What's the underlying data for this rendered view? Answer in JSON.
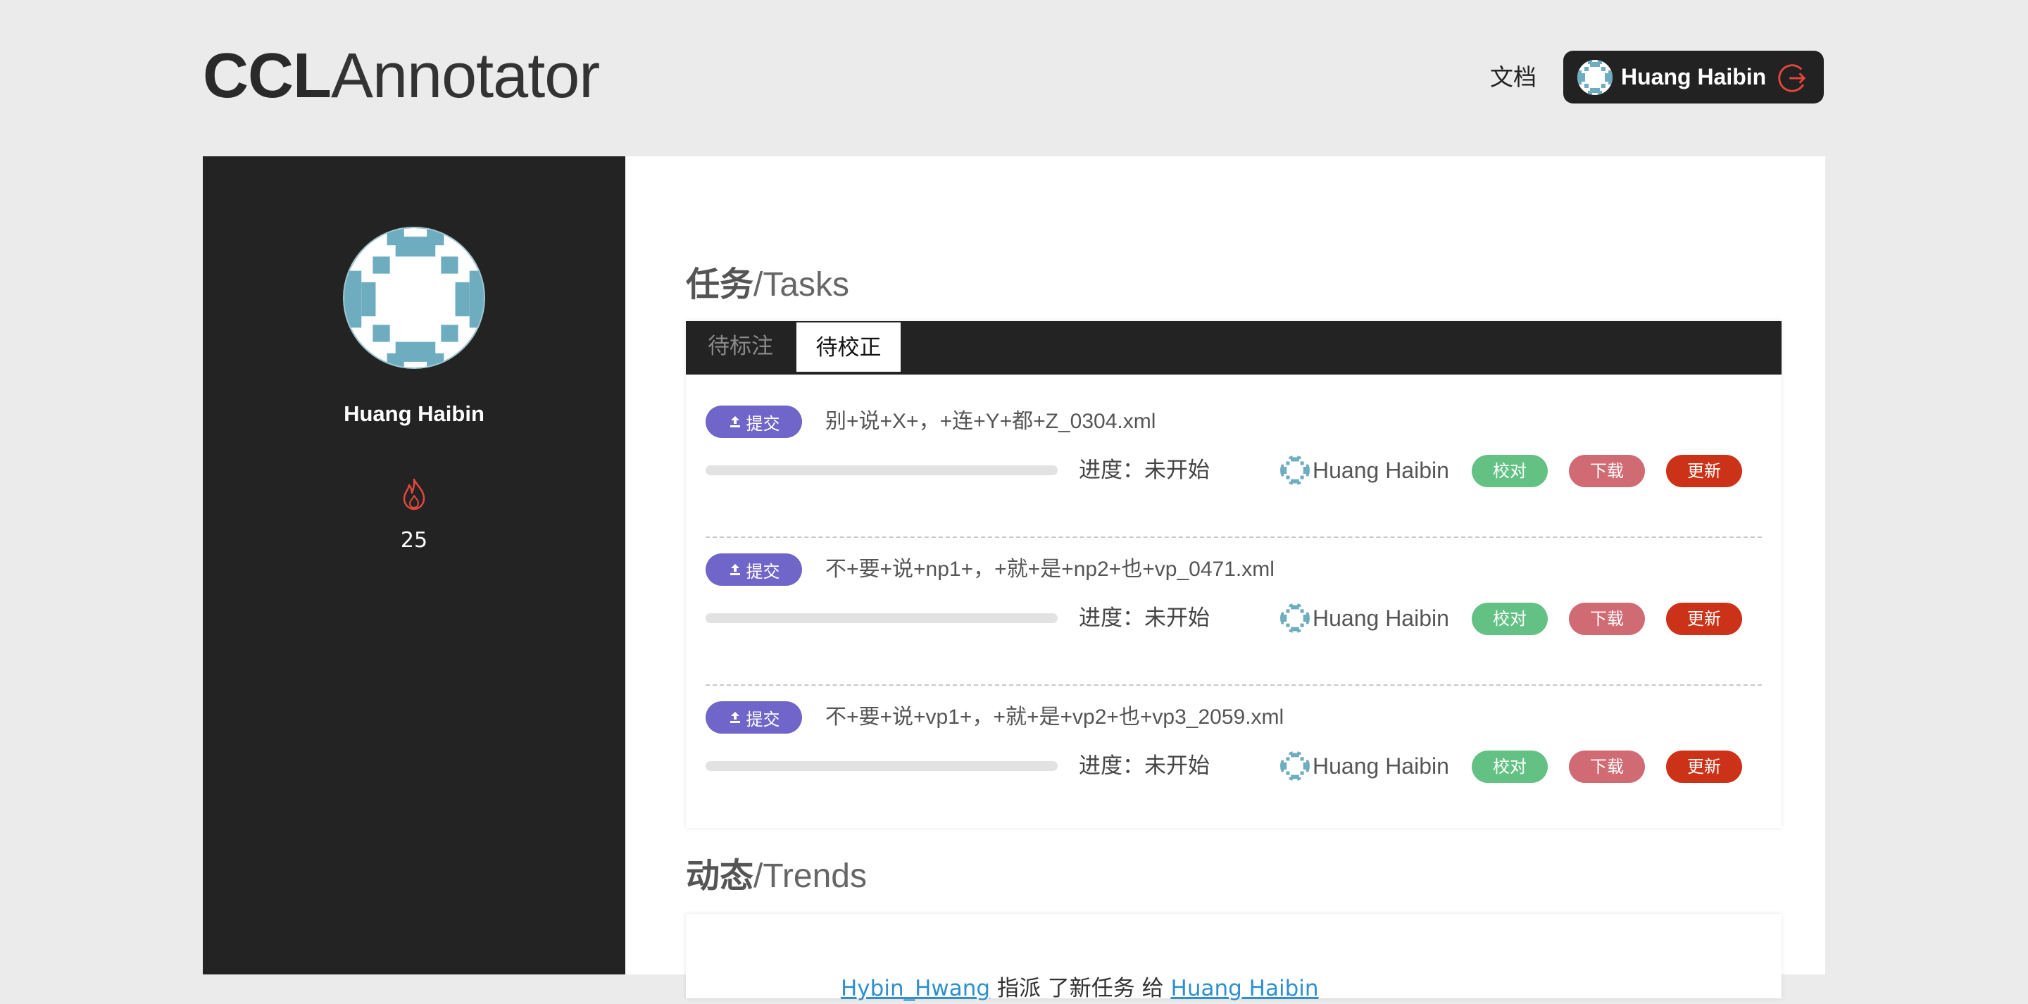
{
  "header": {
    "logo_bold": "CCL",
    "logo_light": "Annotator",
    "docs_link": "文档",
    "user_name": "Huang Haibin"
  },
  "sidebar": {
    "user_name": "Huang Haibin",
    "streak_count": "25"
  },
  "tasks": {
    "title_cn": "任务",
    "title_en": "/Tasks",
    "tabs": [
      {
        "label": "待标注",
        "active": false
      },
      {
        "label": "待校正",
        "active": true
      }
    ],
    "items": [
      {
        "submit_label": "提交",
        "file": "别+说+X+，+连+Y+都+Z_0304.xml",
        "progress_text": "进度：未开始",
        "progress": 0,
        "user": "Huang Haibin",
        "proof_label": "校对",
        "download_label": "下载",
        "update_label": "更新"
      },
      {
        "submit_label": "提交",
        "file": "不+要+说+np1+，+就+是+np2+也+vp_0471.xml",
        "progress_text": "进度：未开始",
        "progress": 0,
        "user": "Huang Haibin",
        "proof_label": "校对",
        "download_label": "下载",
        "update_label": "更新"
      },
      {
        "submit_label": "提交",
        "file": "不+要+说+vp1+，+就+是+vp2+也+vp3_2059.xml",
        "progress_text": "进度：未开始",
        "progress": 0,
        "user": "Huang Haibin",
        "proof_label": "校对",
        "download_label": "下载",
        "update_label": "更新"
      }
    ]
  },
  "trends": {
    "title_cn": "动态",
    "title_en": "/Trends",
    "items": [
      {
        "actor": "Hybin_Hwang",
        "action": " 指派 了新任务 给 ",
        "target": "Huang Haibin"
      }
    ]
  },
  "colors": {
    "accent_purple": "#7065c8",
    "proof_green": "#64c184",
    "download_pink": "#d06a73",
    "update_red": "#cc3218",
    "dark_panel": "#232323",
    "avatar_teal": "#6eadbf"
  },
  "icons": {
    "logout": "logout-icon",
    "fire": "fire-icon",
    "upload": "upload-icon"
  }
}
